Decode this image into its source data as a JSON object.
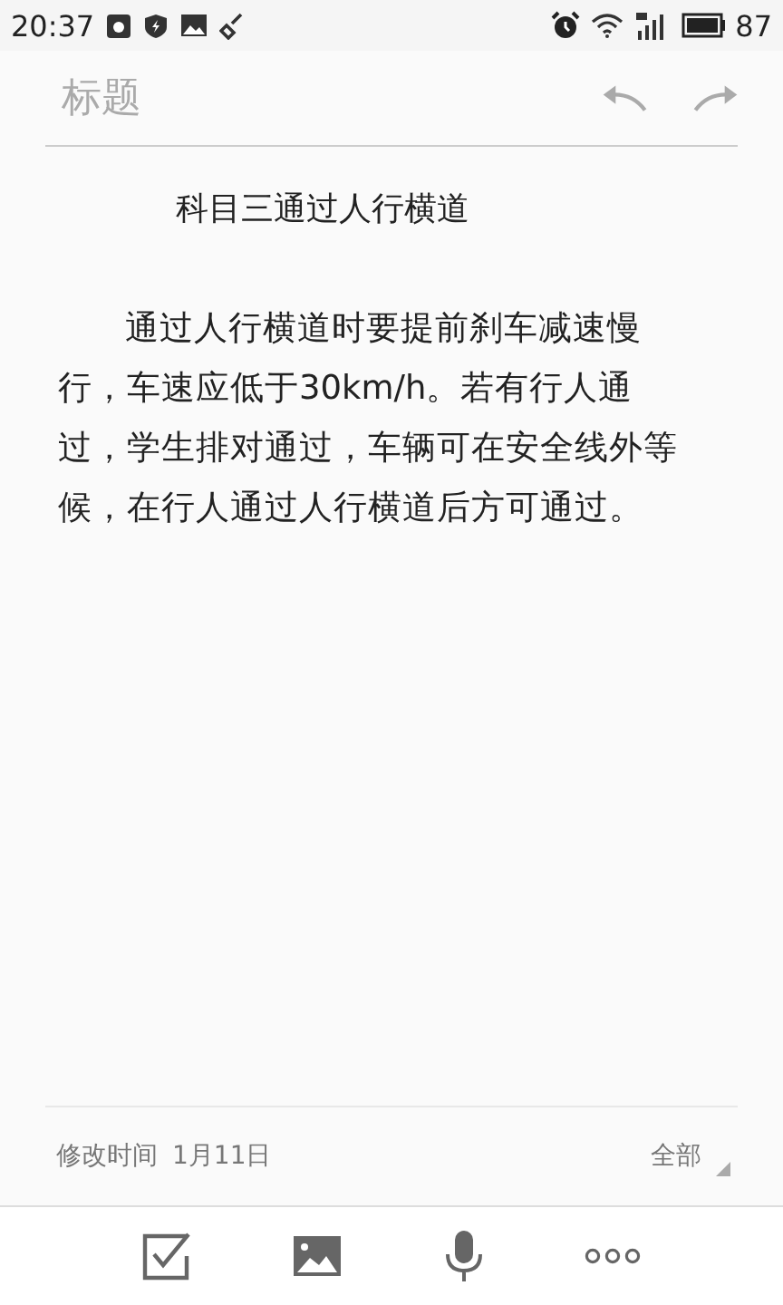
{
  "status_bar": {
    "time": "20:37",
    "battery": "87"
  },
  "title_field": {
    "placeholder": "标题"
  },
  "note": {
    "heading": "科目三通过人行横道",
    "paragraph": "通过人行横道时要提前刹车减速慢行，车速应低于30km/h。若有行人通过，学生排对通过，车辆可在安全线外等候，在行人通过人行横道后方可通过。"
  },
  "footer": {
    "modified_label": "修改时间",
    "modified_date": "1月11日",
    "category": "全部"
  }
}
